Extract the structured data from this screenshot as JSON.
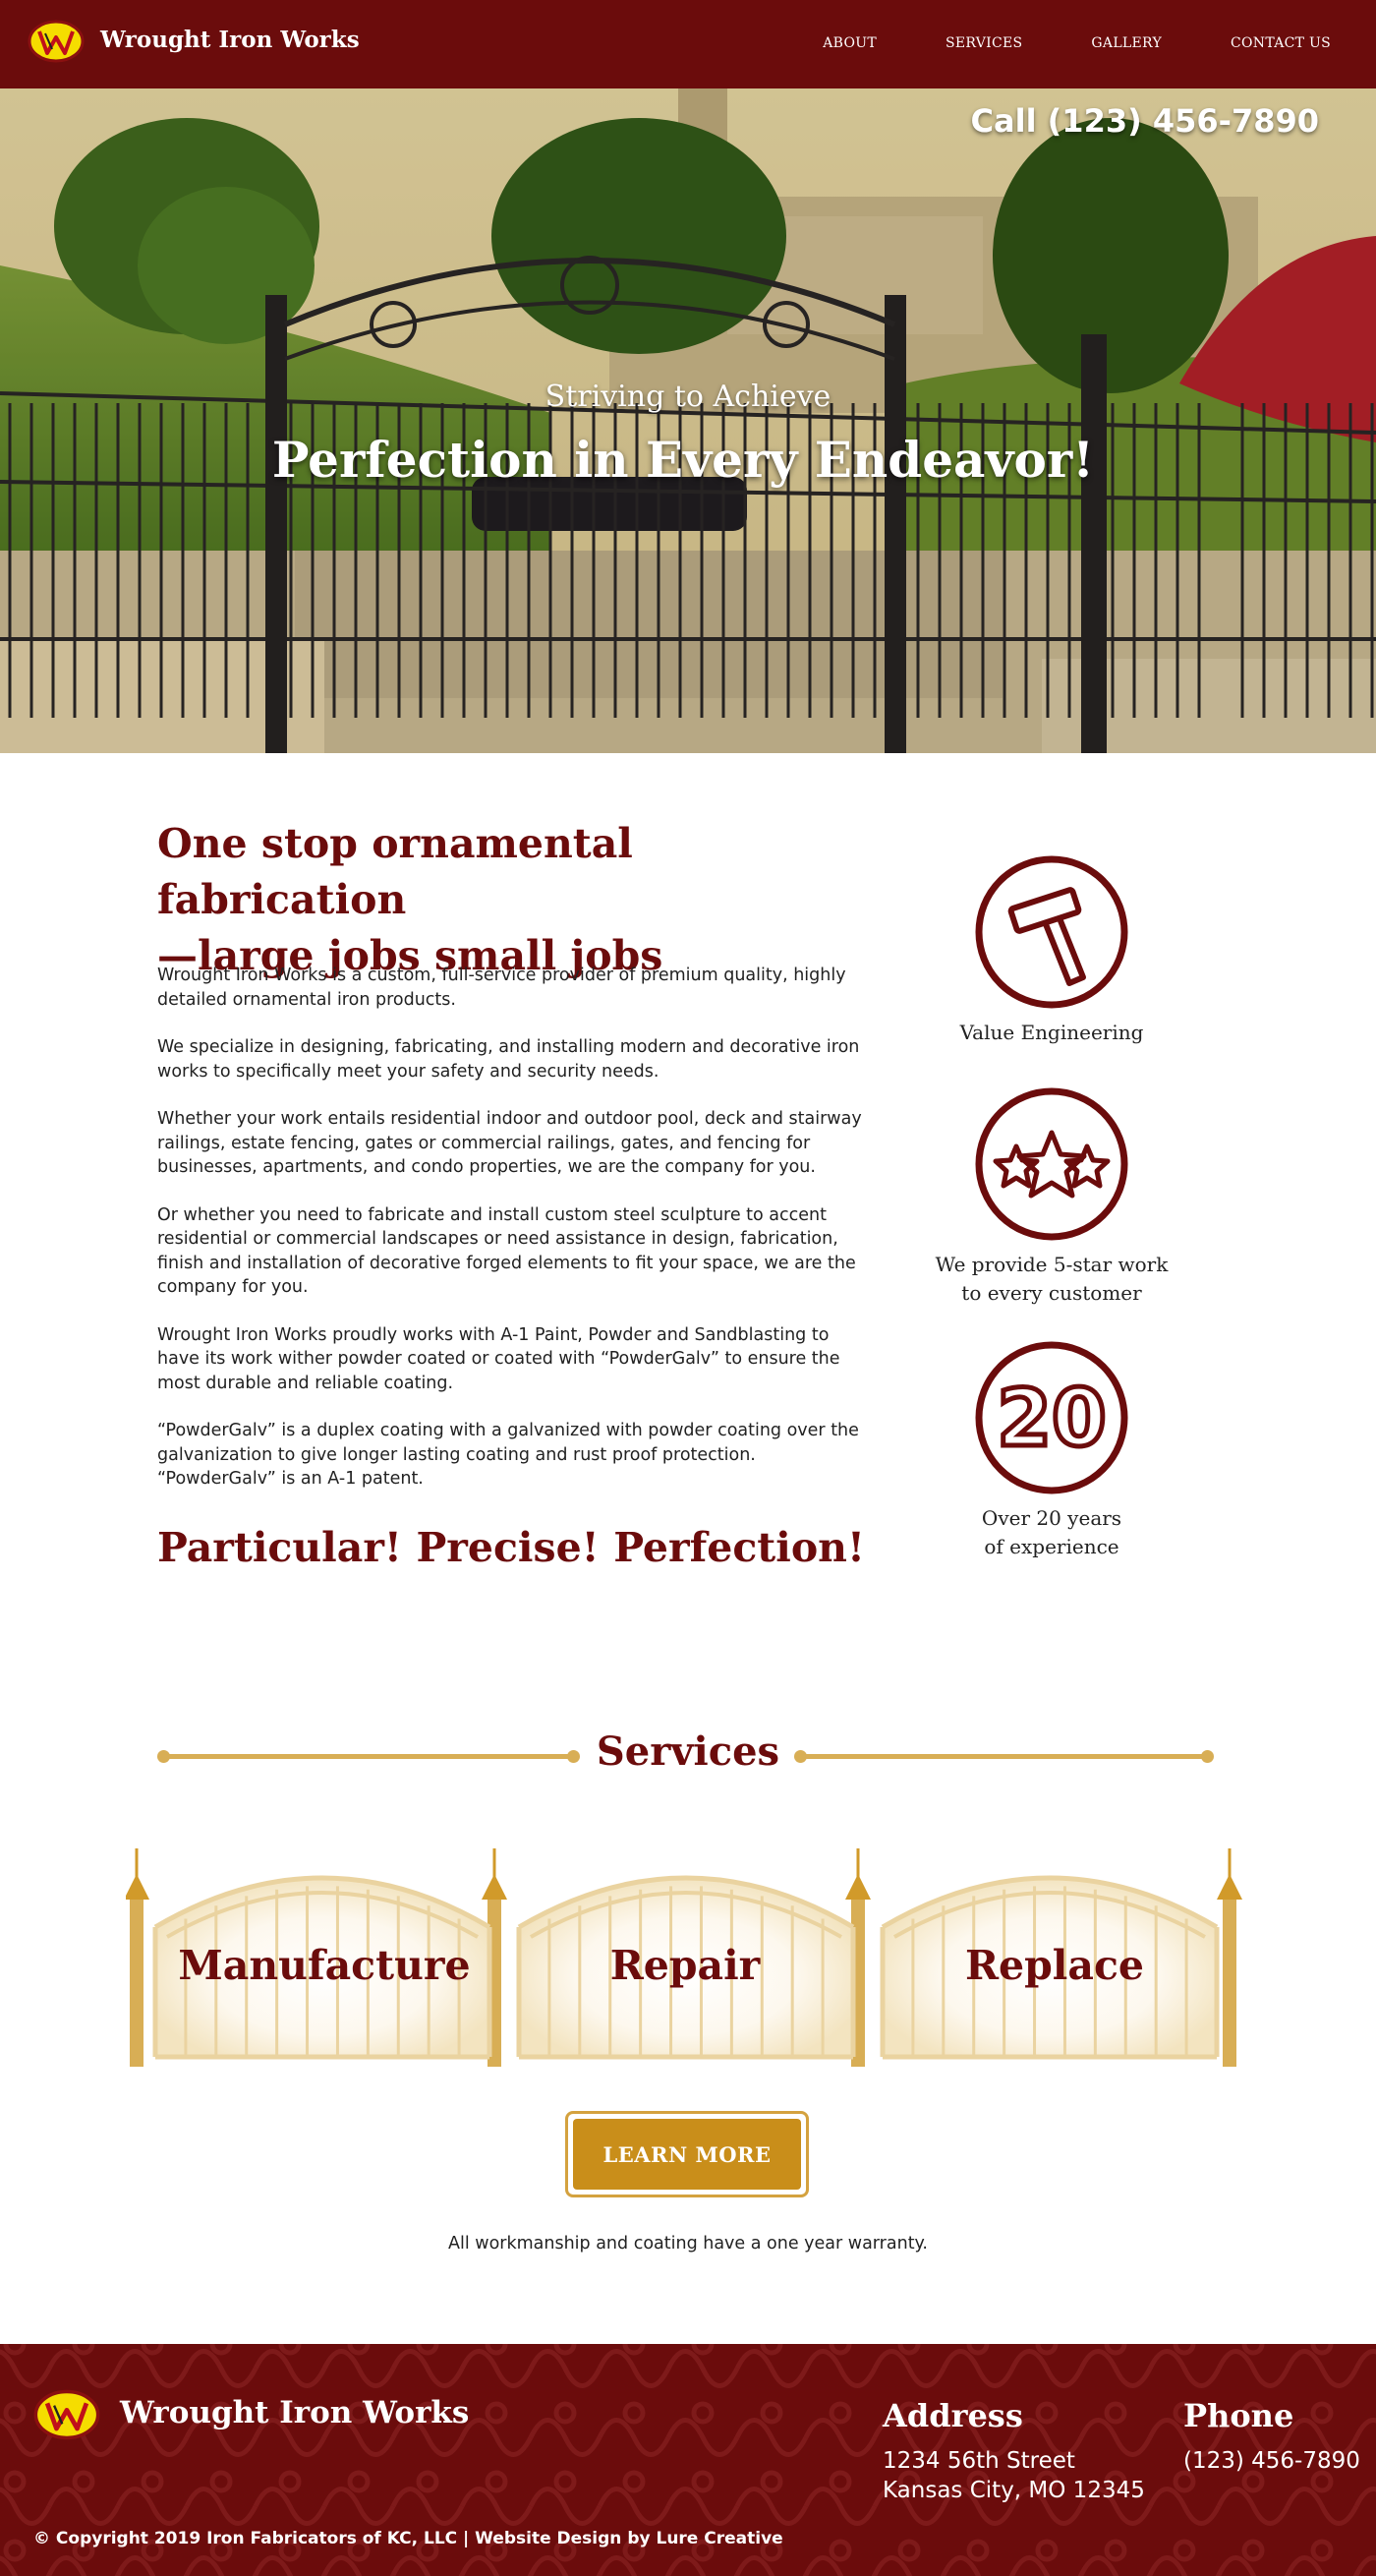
{
  "nav": {
    "brand": "Wrought Iron Works",
    "links": [
      "ABOUT",
      "SERVICES",
      "GALLERY",
      "CONTACT US"
    ]
  },
  "hero": {
    "phone": "Call (123) 456-7890",
    "subtitle": "Striving to Achieve",
    "title": "Perfection in Every Endeavor!"
  },
  "intro": {
    "heading_line1": "One stop ornamental fabrication",
    "heading_line2": "—large jobs small jobs",
    "paragraphs": [
      "Wrought Iron Works is a custom, full-service provider of premium quality, highly detailed ornamental iron products.",
      "We specialize in designing, fabricating, and installing modern and decorative iron works to specifically meet your safety and security needs.",
      "Whether your work entails residential indoor and outdoor pool, deck and stairway railings, estate fencing, gates or commercial railings, gates, and fencing for businesses, apartments, and condo properties, we are the company for you.",
      "Or whether you need to fabricate and install custom steel sculpture to accent residential or commercial landscapes or need assistance in design, fabrication, finish and installation of decorative forged elements to fit your space, we are the company for you.",
      "Wrought Iron Works proudly works with A-1 Paint, Powder and Sandblasting to have its work wither powder coated or coated with “PowderGalv” to ensure the most durable and reliable coating.",
      "“PowderGalv” is a duplex coating with a galvanized with powder coating over the galvanization to give longer lasting coating and rust proof protection. “PowderGalv” is an A-1 patent."
    ],
    "tagline": [
      "Particular!",
      "Precise!",
      "Perfection!"
    ]
  },
  "features": [
    {
      "icon": "hammer-icon",
      "line1": "Value Engineering",
      "line2": ""
    },
    {
      "icon": "five-stars-icon",
      "line1": "We provide 5-star work",
      "line2": "to every customer"
    },
    {
      "icon": "twenty-years-icon",
      "number": "20",
      "line1": "Over 20 years",
      "line2": "of experience"
    }
  ],
  "services": {
    "heading": "Services",
    "items": [
      "Manufacture",
      "Repair",
      "Replace"
    ],
    "button": "LEARN MORE",
    "warranty": "All workmanship and coating have a one year warranty."
  },
  "footer": {
    "brand": "Wrought Iron Works",
    "address_heading": "Address",
    "address_line1": "1234 56th Street",
    "address_line2": "Kansas City, MO 12345",
    "phone_heading": "Phone",
    "phone": "(123) 456-7890",
    "copyright": "© Copyright 2019 Iron Fabricators of KC, LLC | Website Design by Lure Creative"
  },
  "logo_letters": "W",
  "colors": {
    "brand_maroon": "#6b0c0c",
    "gold": "#d8ae55",
    "button_gold": "#c98e1a",
    "logo_yellow": "#f5dd00"
  }
}
